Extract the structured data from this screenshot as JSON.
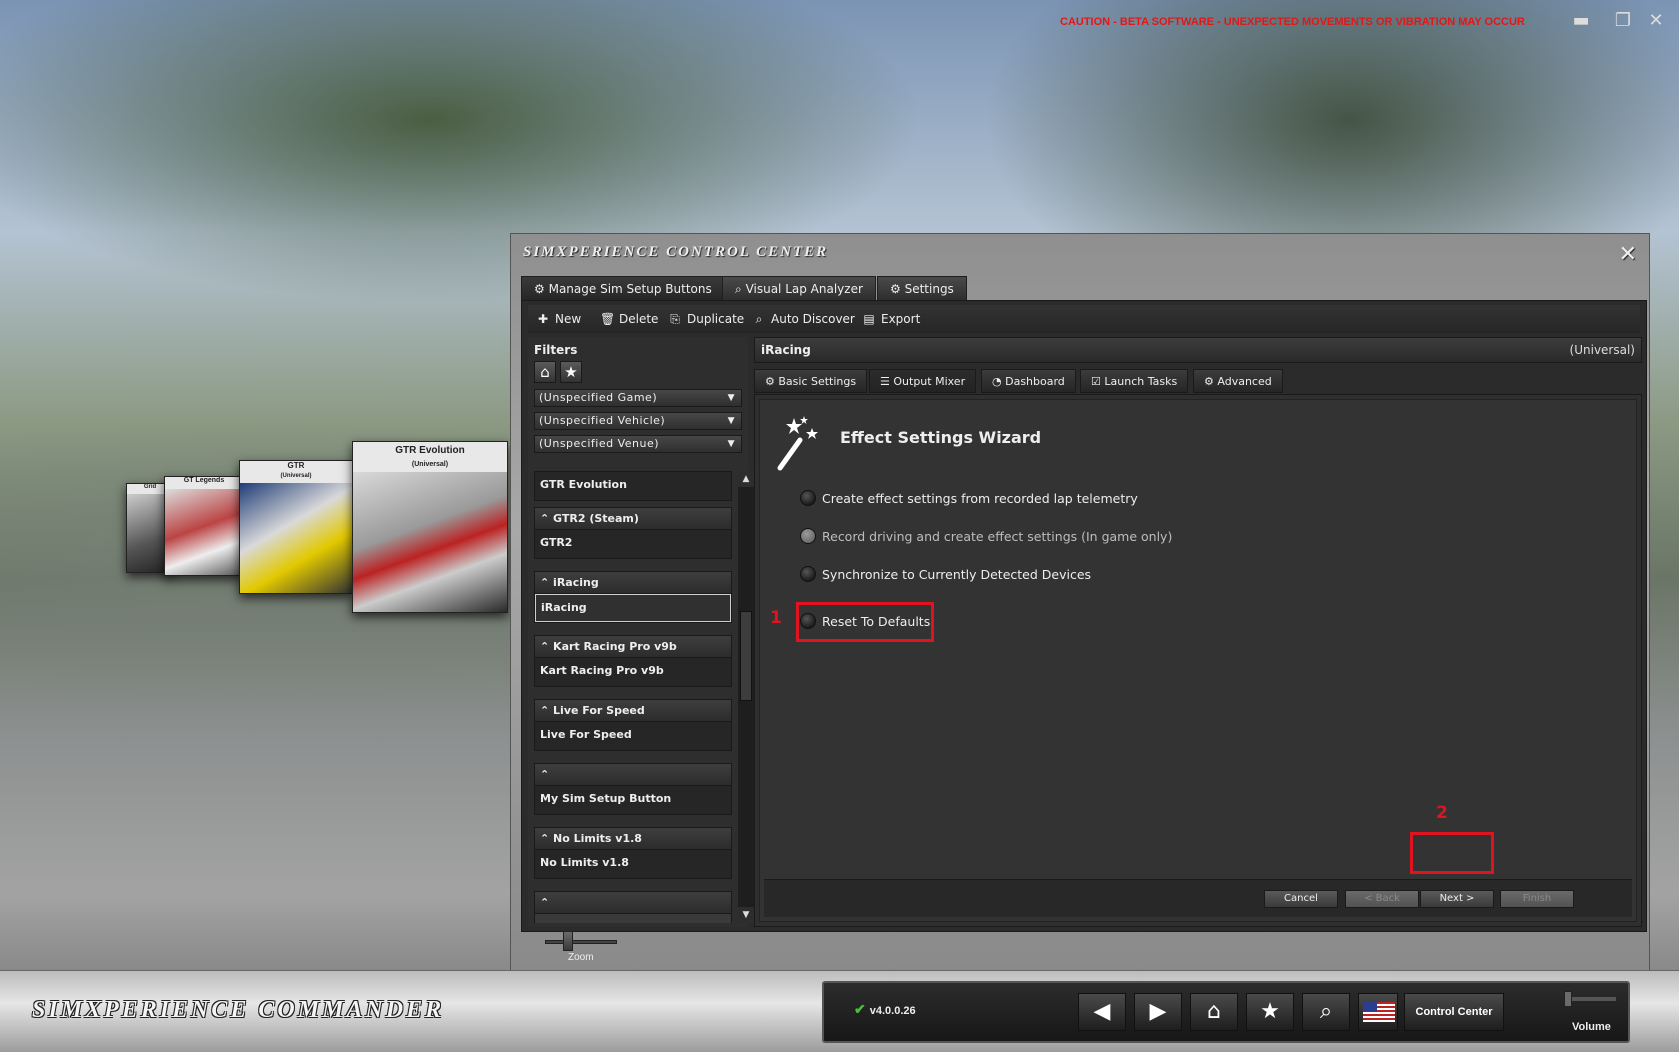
{
  "caution": "CAUTION - BETA SOFTWARE - UNEXPECTED MOVEMENTS OR VIBRATION MAY OCCUR",
  "covers": {
    "gtr_evolution_title": "GTR Evolution",
    "gtr_evolution_sub": "(Universal)",
    "gtr_title": "GTR",
    "gtr_sub": "(Universal)",
    "gt_legends_title": "GT Legends",
    "grid_title": "Grid"
  },
  "window": {
    "title": "SIMXPERIENCE CONTROL CENTER",
    "close": "✕",
    "tabs": [
      {
        "label": "Manage Sim Setup Buttons"
      },
      {
        "label": "Visual Lap Analyzer"
      },
      {
        "label": "Settings"
      }
    ]
  },
  "toolbar": {
    "new": "New",
    "delete": "Delete",
    "duplicate": "Duplicate",
    "auto_discover": "Auto Discover",
    "export": "Export"
  },
  "filters": {
    "title": "Filters",
    "game": "(Unspecified Game)",
    "vehicle": "(Unspecified Vehicle)",
    "venue": "(Unspecified Venue)"
  },
  "list": {
    "top_item": "GTR Evolution",
    "groups": [
      {
        "header": "GTR2 (Steam)",
        "item": "GTR2"
      },
      {
        "header": "iRacing",
        "item": "iRacing"
      },
      {
        "header": "Kart Racing Pro v9b",
        "item": "Kart Racing Pro v9b"
      },
      {
        "header": "Live For Speed",
        "item": "Live For Speed"
      },
      {
        "header": "",
        "item": "My Sim Setup Button"
      },
      {
        "header": "No Limits v1.8",
        "item": "No Limits v1.8"
      }
    ]
  },
  "game": {
    "name": "iRacing",
    "scope": "(Universal)"
  },
  "subtabs": [
    {
      "label": "Basic Settings"
    },
    {
      "label": "Output Mixer"
    },
    {
      "label": "Dashboard"
    },
    {
      "label": "Launch Tasks"
    },
    {
      "label": "Advanced"
    }
  ],
  "wizard": {
    "title": "Effect Settings Wizard",
    "options": [
      {
        "label": "Create effect settings from recorded lap telemetry"
      },
      {
        "label": "Record driving and create effect settings (In game only)"
      },
      {
        "label": "Synchronize to Currently Detected Devices"
      },
      {
        "label": "Reset To Defaults"
      }
    ],
    "marker_1": "1",
    "marker_2": "2",
    "buttons": {
      "cancel": "Cancel",
      "back": "< Back",
      "next": "Next >",
      "finish": "Finish"
    }
  },
  "zoom_label": "Zoom",
  "bottom": {
    "brand": "SIMXPERIENCE COMMANDER",
    "version": "v4.0.0.26",
    "control_center": "Control Center",
    "volume": "Volume"
  },
  "colors": {
    "caution": "#e01818",
    "highlight": "#e0141e",
    "check": "#44c437"
  }
}
